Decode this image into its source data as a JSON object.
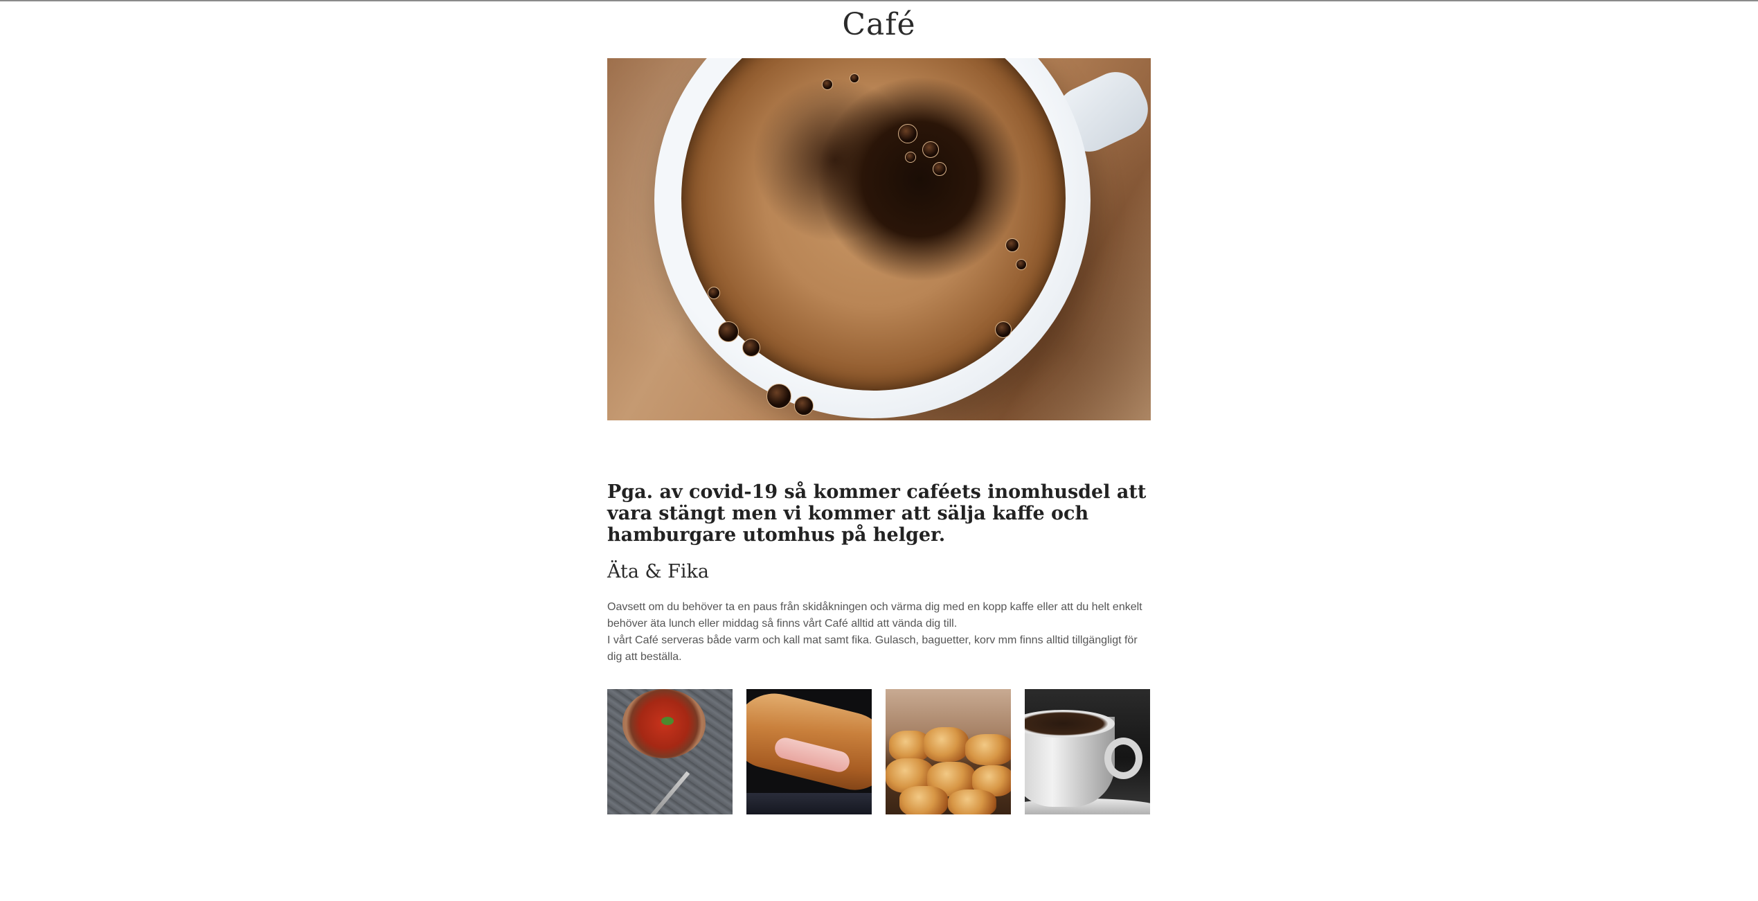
{
  "header": {
    "title": "Café"
  },
  "hero": {
    "image": "coffee-cup-top-view"
  },
  "notice": {
    "text": "Pga. av covid-19 så kommer caféets inomhusdel att vara stängt men vi kommer att sälja kaffe och hamburgare utomhus på helger."
  },
  "section": {
    "heading": "Äta & Fika",
    "paragraph_1": "Oavsett om du behöver ta en paus från skidåkningen och värma dig med en kopp kaffe eller att du helt enkelt behöver äta lunch eller middag så finns vårt Café alltid att vända dig till.",
    "paragraph_2": "I vårt Café serveras både varm och kall mat samt fika. Gulasch, baguetter, korv mm finns alltid tillgängligt för dig att beställa."
  },
  "gallery": {
    "items": [
      {
        "name": "gulasch-soup-photo"
      },
      {
        "name": "baguette-photo"
      },
      {
        "name": "pastries-photo"
      },
      {
        "name": "coffee-cup-photo"
      }
    ]
  },
  "colors": {
    "background": "#ffffff",
    "heading": "#222222",
    "body_text": "#555555",
    "top_border": "#8a8a8a"
  }
}
